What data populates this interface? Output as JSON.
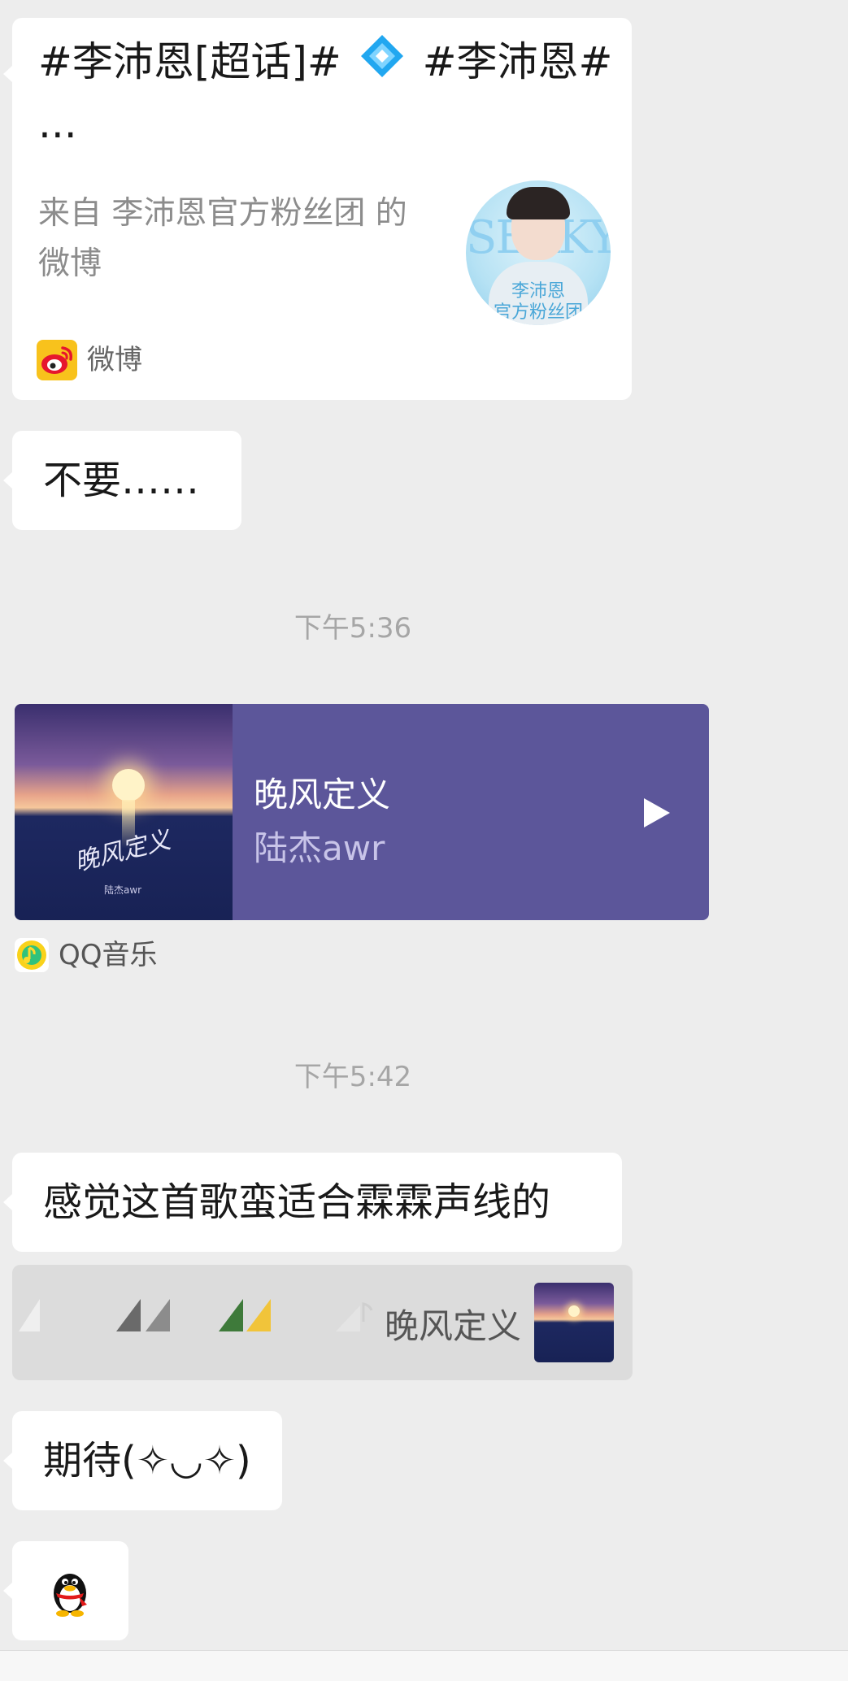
{
  "weibo_card": {
    "title_line1": "#李沛恩[超话]#",
    "title_line1b": "#李沛恩#",
    "title_line2": "...",
    "desc_line1": "来自 李沛恩官方粉丝团 的",
    "desc_line2": "微博",
    "thumb_text_top": "SEAKY",
    "thumb_text_1": "李沛恩",
    "thumb_text_2": "官方粉丝团",
    "source_label": "微博"
  },
  "messages": {
    "m1": "不要……",
    "time1": "下午5:36",
    "time2": "下午5:42",
    "m2": "感觉这首歌蛮适合霖霖声线的",
    "m3": "期待(✧◡✧)"
  },
  "music_card": {
    "title": "晚风定义",
    "artist": "陆杰awr",
    "cover_script": "晚风定义",
    "cover_small": "陆杰awr",
    "source_label": "QQ音乐"
  },
  "quote": {
    "text": "晚风定义"
  },
  "colors": {
    "background": "#ededed",
    "bubble": "#ffffff",
    "music_card": "#5c569a",
    "weibo_red": "#e6162d",
    "weibo_yellow": "#f8c21c",
    "qq_green": "#31c27c"
  }
}
